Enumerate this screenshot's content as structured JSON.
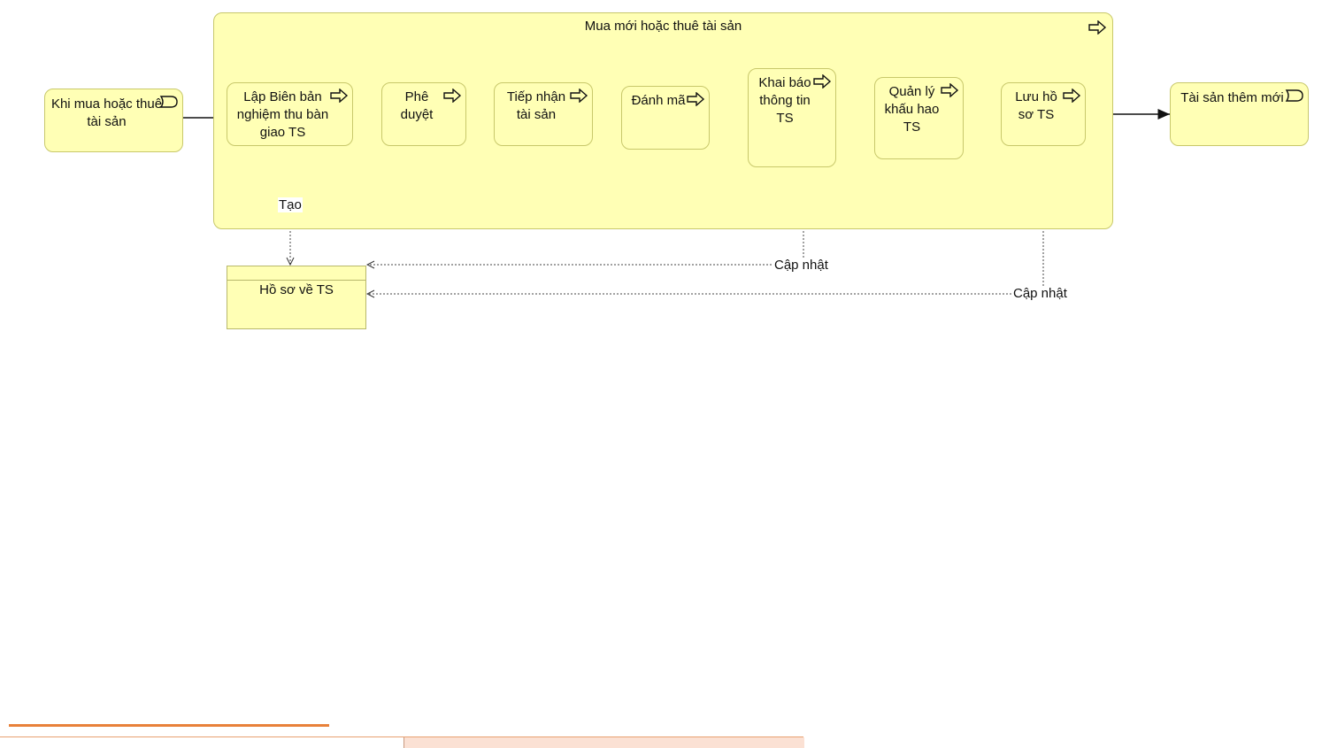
{
  "container": {
    "title": "Mua mới hoặc thuê tài sản",
    "icon": "process-arrow-icon"
  },
  "start_event": {
    "label": "Khi mua hoặc thuê tài sản",
    "icon": "event-icon"
  },
  "end_event": {
    "label": "Tài sản thêm mới",
    "icon": "event-icon"
  },
  "steps": [
    {
      "label": "Lập Biên bản nghiệm thu bàn giao TS"
    },
    {
      "label": "Phê duyệt"
    },
    {
      "label": "Tiếp nhận tài sản"
    },
    {
      "label": "Đánh mã"
    },
    {
      "label": "Khai báo thông tin TS"
    },
    {
      "label": "Quản lý khấu hao TS"
    },
    {
      "label": "Lưu hồ sơ TS"
    }
  ],
  "data_object": {
    "label": "Hồ sơ về TS"
  },
  "relations": {
    "create": "Tạo",
    "update_1": "Cập nhật",
    "update_2": "Cập nhật"
  },
  "colors": {
    "fill": "#ffffb5",
    "border": "#c8c86b",
    "accent": "#e8813a"
  }
}
